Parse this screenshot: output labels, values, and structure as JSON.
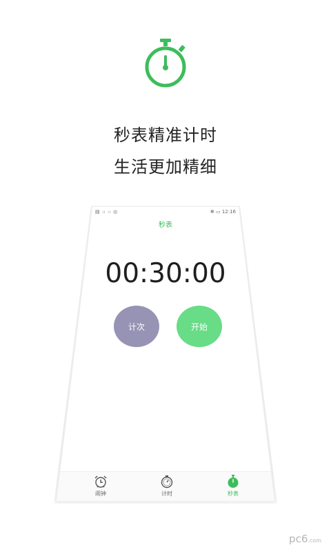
{
  "hero": {
    "icon": "stopwatch-icon",
    "line1": "秒表精准计时",
    "line2": "生活更加精细"
  },
  "phone": {
    "status": {
      "left": "▤ ᵢₗ ᵢₗ ◎",
      "right": "✻ ▭ 12:16"
    },
    "title": "秒表",
    "time": "00:30:00",
    "buttons": {
      "lap": "计次",
      "start": "开始"
    },
    "tabs": [
      {
        "label": "闹钟",
        "icon": "alarm-clock-icon"
      },
      {
        "label": "计时",
        "icon": "timer-icon"
      },
      {
        "label": "秒表",
        "icon": "stopwatch-icon",
        "active": true
      }
    ]
  },
  "watermark": {
    "text": "pc6",
    "suffix": ".com"
  },
  "colors": {
    "accent": "#3cbd5c",
    "lap_button": "#9793b4",
    "start_button": "#68dc86"
  }
}
